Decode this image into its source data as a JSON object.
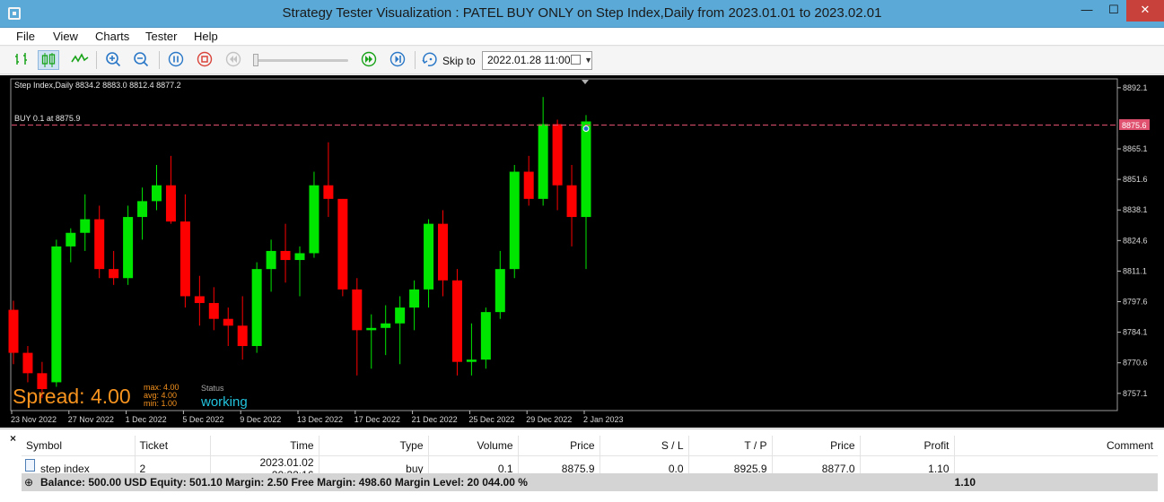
{
  "window": {
    "title": "Strategy Tester Visualization : PATEL BUY ONLY on Step Index,Daily from 2023.01.01 to 2023.02.01",
    "min_glyph": "—",
    "max_glyph": "☐",
    "close_glyph": "✕"
  },
  "menu": [
    "File",
    "View",
    "Charts",
    "Tester",
    "Help"
  ],
  "toolbar": {
    "icons": [
      "bar-chart-icon",
      "candlestick-chart-icon",
      "line-chart-icon",
      "zoom-in-icon",
      "zoom-out-icon",
      "pause-icon",
      "stop-icon",
      "step-back-icon",
      "fast-forward-icon",
      "step-forward-icon",
      "skip-to-icon"
    ],
    "skip_label": "Skip to",
    "skip_value": "2022.01.28 11:00"
  },
  "chart": {
    "header": "Step Index,Daily  8834.2 8883.0 8812.4 8877.2",
    "order_label": "BUY 0.1 at 8875.9",
    "current_price": "8875.6",
    "spread": "Spread: 4.00",
    "max_label": "max: 4.00",
    "avg_label": "avg: 4.00",
    "min_label": "min:  1.00",
    "status_label": "Status",
    "status_value": "working",
    "colors": {
      "bull": "#00e600",
      "bear": "#ff0000",
      "order_line": "#e0516f",
      "spread": "#f7931e",
      "status": "#22c3dd"
    }
  },
  "chart_data": {
    "type": "candlestick",
    "price_ticks": [
      "8892.1",
      "8865.1",
      "8851.6",
      "8838.1",
      "8824.6",
      "8811.1",
      "8797.6",
      "8784.1",
      "8770.6",
      "8757.1"
    ],
    "date_ticks": [
      "23 Nov 2022",
      "27 Nov 2022",
      "1 Dec 2022",
      "5 Dec 2022",
      "9 Dec 2022",
      "13 Dec 2022",
      "17 Dec 2022",
      "21 Dec 2022",
      "25 Dec 2022",
      "29 Dec 2022",
      "2 Jan 2023"
    ],
    "ylim": [
      8749.5,
      8896.0
    ],
    "candles": [
      [
        8794,
        8798,
        8770,
        8775
      ],
      [
        8775,
        8778,
        8762,
        8766
      ],
      [
        8766,
        8771,
        8755,
        8759
      ],
      [
        8762,
        8825,
        8760,
        8822
      ],
      [
        8822,
        8830,
        8815,
        8828
      ],
      [
        8828,
        8845,
        8820,
        8834
      ],
      [
        8834,
        8840,
        8808,
        8812
      ],
      [
        8812,
        8820,
        8805,
        8808
      ],
      [
        8808,
        8840,
        8805,
        8835
      ],
      [
        8835,
        8848,
        8825,
        8842
      ],
      [
        8842,
        8858,
        8838,
        8849
      ],
      [
        8849,
        8862,
        8832,
        8833
      ],
      [
        8833,
        8845,
        8795,
        8800
      ],
      [
        8800,
        8809,
        8787,
        8797
      ],
      [
        8797,
        8804,
        8785,
        8790
      ],
      [
        8790,
        8795,
        8778,
        8787
      ],
      [
        8787,
        8800,
        8772,
        8778
      ],
      [
        8778,
        8815,
        8775,
        8812
      ],
      [
        8812,
        8825,
        8802,
        8820
      ],
      [
        8820,
        8832,
        8806,
        8816
      ],
      [
        8816,
        8822,
        8800,
        8819
      ],
      [
        8819,
        8855,
        8817,
        8849
      ],
      [
        8849,
        8868,
        8835,
        8843
      ],
      [
        8843,
        8842,
        8800,
        8803
      ],
      [
        8803,
        8808,
        8765,
        8785
      ],
      [
        8785,
        8792,
        8768,
        8786
      ],
      [
        8786,
        8796,
        8774,
        8788
      ],
      [
        8788,
        8800,
        8770,
        8795
      ],
      [
        8795,
        8807,
        8785,
        8803
      ],
      [
        8803,
        8834,
        8795,
        8832
      ],
      [
        8832,
        8838,
        8800,
        8807
      ],
      [
        8807,
        8812,
        8765,
        8771
      ],
      [
        8771,
        8788,
        8765,
        8772
      ],
      [
        8772,
        8795,
        8768,
        8793
      ],
      [
        8793,
        8820,
        8790,
        8812
      ],
      [
        8812,
        8858,
        8808,
        8855
      ],
      [
        8855,
        8862,
        8840,
        8843
      ],
      [
        8843,
        8888,
        8840,
        8876
      ],
      [
        8876,
        8878,
        8838,
        8849
      ],
      [
        8849,
        8858,
        8822,
        8835
      ],
      [
        8835,
        8880,
        8812,
        8877.2
      ]
    ]
  },
  "trades": {
    "headers": [
      "Symbol",
      "Ticket",
      "Time",
      "Type",
      "Volume",
      "Price",
      "S / L",
      "T / P",
      "Price",
      "Profit",
      "Comment"
    ],
    "rows": [
      [
        "step index",
        "2",
        "2023.01.02 20:32:16",
        "buy",
        "0.1",
        "8875.9",
        "0.0",
        "8925.9",
        "8877.0",
        "1.10",
        ""
      ]
    ],
    "close_glyph": "×",
    "balance_icon": "⊕",
    "balance_text": "Balance: 500.00 USD  Equity: 501.10  Margin: 2.50  Free Margin: 498.60  Margin Level: 20 044.00 %",
    "balance_profit": "1.10"
  }
}
